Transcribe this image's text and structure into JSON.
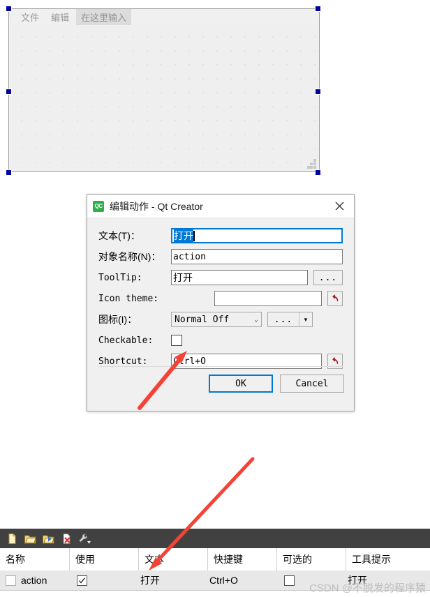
{
  "designer": {
    "menubar": [
      {
        "label": "文件",
        "placeholder": false
      },
      {
        "label": "编辑",
        "placeholder": false
      },
      {
        "label": "在这里输入",
        "placeholder": true
      }
    ],
    "selection_handle_color": "#00009f",
    "canvas_bg": "#efefef"
  },
  "dialog": {
    "icon": "qt-creator-icon",
    "icon_text": "QC",
    "title": "编辑动作 - Qt Creator",
    "close_label": "close-icon",
    "accent": "#0078d7",
    "fields": {
      "text": {
        "label": "文本(T)：",
        "value": "打开",
        "selected": true,
        "focused": true
      },
      "object_name": {
        "label": "对象名称(N)：",
        "value": "action"
      },
      "tooltip": {
        "label": "ToolTip:",
        "value": "打开",
        "browse_label": "..."
      },
      "icon_theme": {
        "label": "Icon theme:",
        "value": "",
        "reset_label": "reset-icon"
      },
      "icon": {
        "label": "图标(I)：",
        "value": "Normal Off",
        "browse_label": "...",
        "dropdown_label": "▼"
      },
      "checkable": {
        "label": "Checkable:",
        "checked": false
      },
      "shortcut": {
        "label": "Shortcut:",
        "value": "Ctrl+O",
        "reset_label": "reset-icon"
      }
    },
    "buttons": {
      "ok": "OK",
      "cancel": "Cancel"
    }
  },
  "bottom_panel": {
    "toolbar": [
      {
        "name": "new-action-icon"
      },
      {
        "name": "open-folder-icon"
      },
      {
        "name": "edit-folder-icon"
      },
      {
        "name": "delete-action-icon"
      },
      {
        "name": "settings-wrench-icon"
      }
    ],
    "table": {
      "columns": [
        "名称",
        "使用",
        "文本",
        "快捷键",
        "可选的",
        "工具提示"
      ],
      "rows": [
        {
          "name": "action",
          "used": true,
          "text": "打开",
          "shortcut": "Ctrl+O",
          "checkable": false,
          "tooltip": "打开"
        }
      ]
    },
    "watermark": "CSDN @不脱发的程序猿"
  },
  "annotations": {
    "arrow_color": "#f44336",
    "arrows": [
      {
        "name": "arrow-to-shortcut-field"
      },
      {
        "name": "arrow-to-text-column"
      }
    ]
  }
}
